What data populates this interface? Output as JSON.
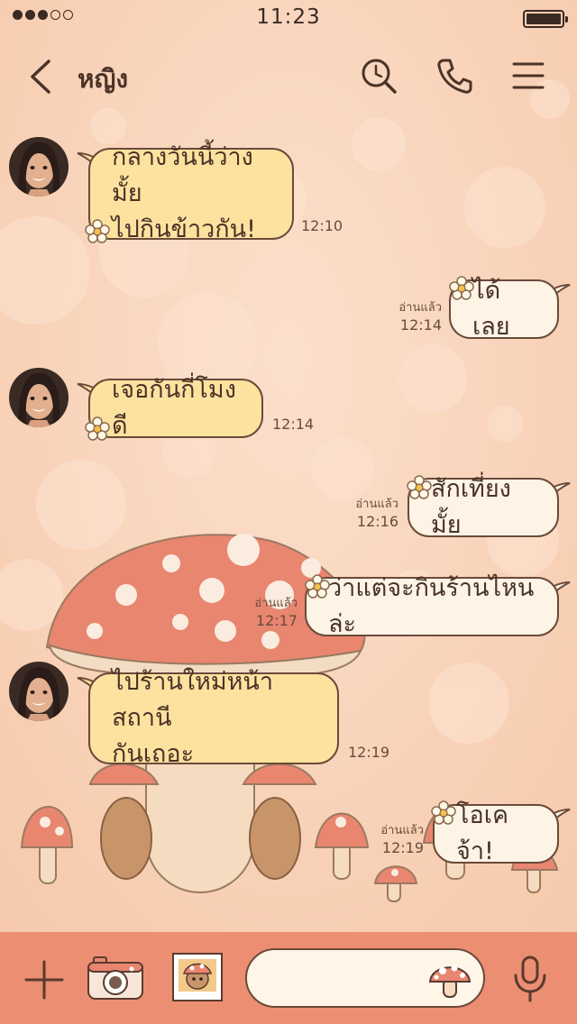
{
  "status_bar": {
    "time": "11:23",
    "signal_dots": 5,
    "signal_filled": 3
  },
  "header": {
    "title": "หญิง",
    "icons": [
      "back-icon",
      "search-icon",
      "phone-icon",
      "menu-icon"
    ]
  },
  "messages": [
    {
      "side": "in",
      "text": "กลางวันนี้ว่างมั้ย\nไปกินข้าวกัน!",
      "time": "12:10"
    },
    {
      "side": "out",
      "text": "ได้เลย",
      "read": "อ่านแล้ว",
      "time": "12:14"
    },
    {
      "side": "in",
      "text": "เจอกันกี่โมงดี",
      "time": "12:14"
    },
    {
      "side": "out",
      "text": "สักเที่ยงมั้ย",
      "read": "อ่านแล้ว",
      "time": "12:16"
    },
    {
      "side": "out",
      "text": "ว่าแต่จะกินร้านไหนล่ะ",
      "read": "อ่านแล้ว",
      "time": "12:17"
    },
    {
      "side": "in",
      "text": "ไปร้านใหม่หน้าสถานี\nกันเถอะ",
      "time": "12:19"
    },
    {
      "side": "out",
      "text": "โอเคจ้า!",
      "read": "อ่านแล้ว",
      "time": "12:19"
    }
  ],
  "input_bar": {
    "icons": [
      "plus-icon",
      "camera-icon",
      "photo-icon",
      "mushroom-sticker-icon",
      "microphone-icon"
    ],
    "placeholder": ""
  },
  "colors": {
    "background": "#f9d6bd",
    "incoming_bubble": "#fde29f",
    "outgoing_bubble": "#fdf4e6",
    "outline": "#6b4a3a",
    "input_bar": "#ec8e72",
    "mushroom_cap": "#e98670"
  }
}
